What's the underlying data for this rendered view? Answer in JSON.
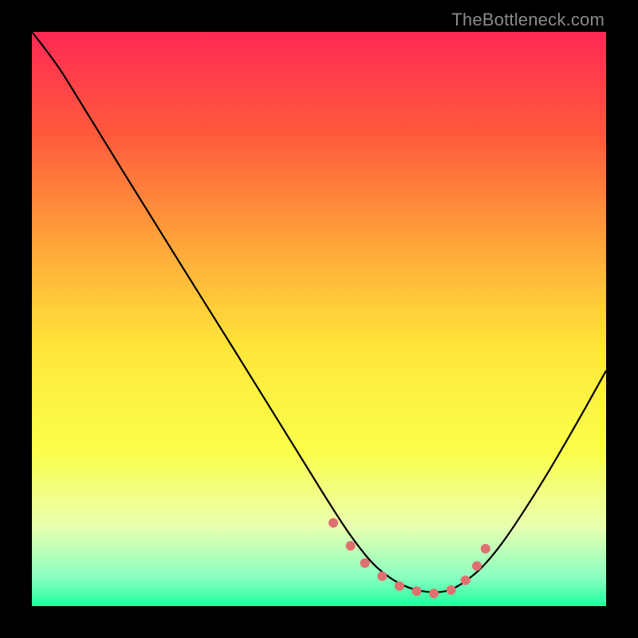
{
  "watermark": "TheBottleneck.com",
  "chart_data": {
    "type": "line",
    "title": "",
    "xlabel": "",
    "ylabel": "",
    "xlim": [
      0,
      100
    ],
    "ylim": [
      0,
      100
    ],
    "gradient_stops": [
      {
        "offset": 0,
        "color": "#ff2a55"
      },
      {
        "offset": 18,
        "color": "#ff5a3c"
      },
      {
        "offset": 38,
        "color": "#ffa93a"
      },
      {
        "offset": 55,
        "color": "#ffe63a"
      },
      {
        "offset": 73,
        "color": "#fbff4a"
      },
      {
        "offset": 86,
        "color": "#eaffb0"
      },
      {
        "offset": 95,
        "color": "#8affc0"
      },
      {
        "offset": 100,
        "color": "#1fff9a"
      }
    ],
    "series": [
      {
        "name": "bottleneck-curve",
        "color": "#000000",
        "x": [
          0.0,
          4.0,
          8.0,
          12.0,
          20.0,
          30.0,
          40.0,
          48.0,
          53.0,
          56.0,
          60.0,
          65.0,
          70.0,
          74.0,
          80.0,
          88.0,
          95.0,
          100.0
        ],
        "y": [
          100.0,
          95.0,
          88.5,
          82.0,
          69.0,
          53.0,
          37.0,
          24.0,
          16.0,
          11.5,
          6.5,
          3.2,
          2.2,
          3.0,
          8.0,
          20.0,
          32.0,
          41.0
        ]
      },
      {
        "name": "valley-markers",
        "color": "#e07070",
        "marker_type": "dot",
        "x": [
          52.5,
          55.5,
          58.0,
          61.0,
          64.0,
          67.0,
          70.0,
          73.0,
          75.5,
          77.5,
          79.0
        ],
        "y": [
          14.5,
          10.5,
          7.5,
          5.2,
          3.5,
          2.6,
          2.2,
          2.8,
          4.5,
          7.0,
          10.0
        ]
      }
    ],
    "legend": []
  }
}
